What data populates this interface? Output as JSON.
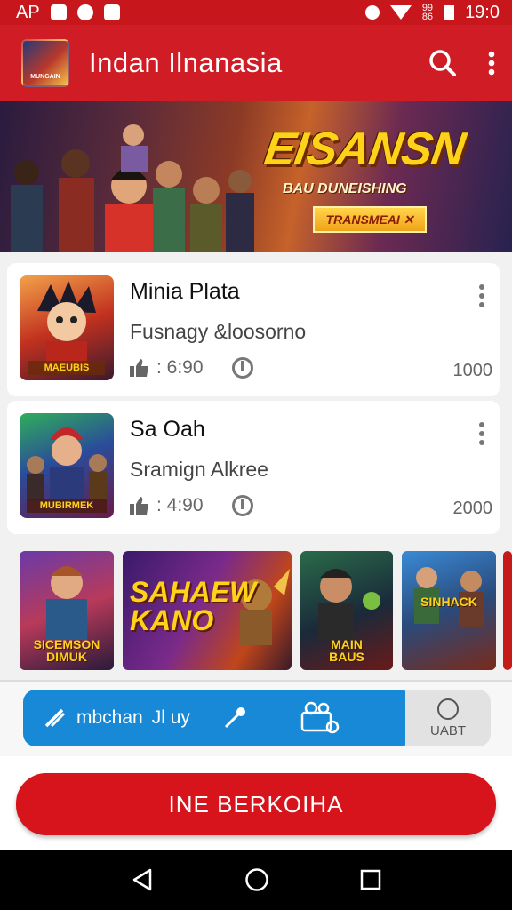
{
  "status_bar": {
    "left_text": "AP",
    "right_small": "99\n86",
    "time": "19:0"
  },
  "app_bar": {
    "logo_text": "MUNGAIN",
    "title": "Indan Ilnanasia"
  },
  "banner": {
    "title": "EISANSN",
    "subtitle": "BAU DUNEISHING",
    "tag": "TRANSMEAI ✕"
  },
  "list": [
    {
      "title": "Minia Plata",
      "subtitle": "Fusnagy  &loosorno",
      "stat": ": 6:90",
      "count": "1000",
      "thumb_label": "MAEUBIS"
    },
    {
      "title": "Sa Oah",
      "subtitle": "Sramign  Alkree",
      "stat": ": 4:90",
      "count": "2000",
      "thumb_label": "MUBIRMEK"
    }
  ],
  "carousel": [
    {
      "label": "SICEMSON\nDIMUK"
    },
    {
      "label": "SAHAEW\nKANO"
    },
    {
      "label": "MAIN\nBAUS"
    },
    {
      "label": "SINHACK"
    }
  ],
  "tabbar": {
    "primary_label": "mbchan",
    "mid_text": "Jl uy",
    "right_label": "UABT"
  },
  "cta": {
    "label": "INE BERKOIHA"
  },
  "colors": {
    "primary_red": "#d01c24",
    "tab_blue": "#1789d6"
  }
}
